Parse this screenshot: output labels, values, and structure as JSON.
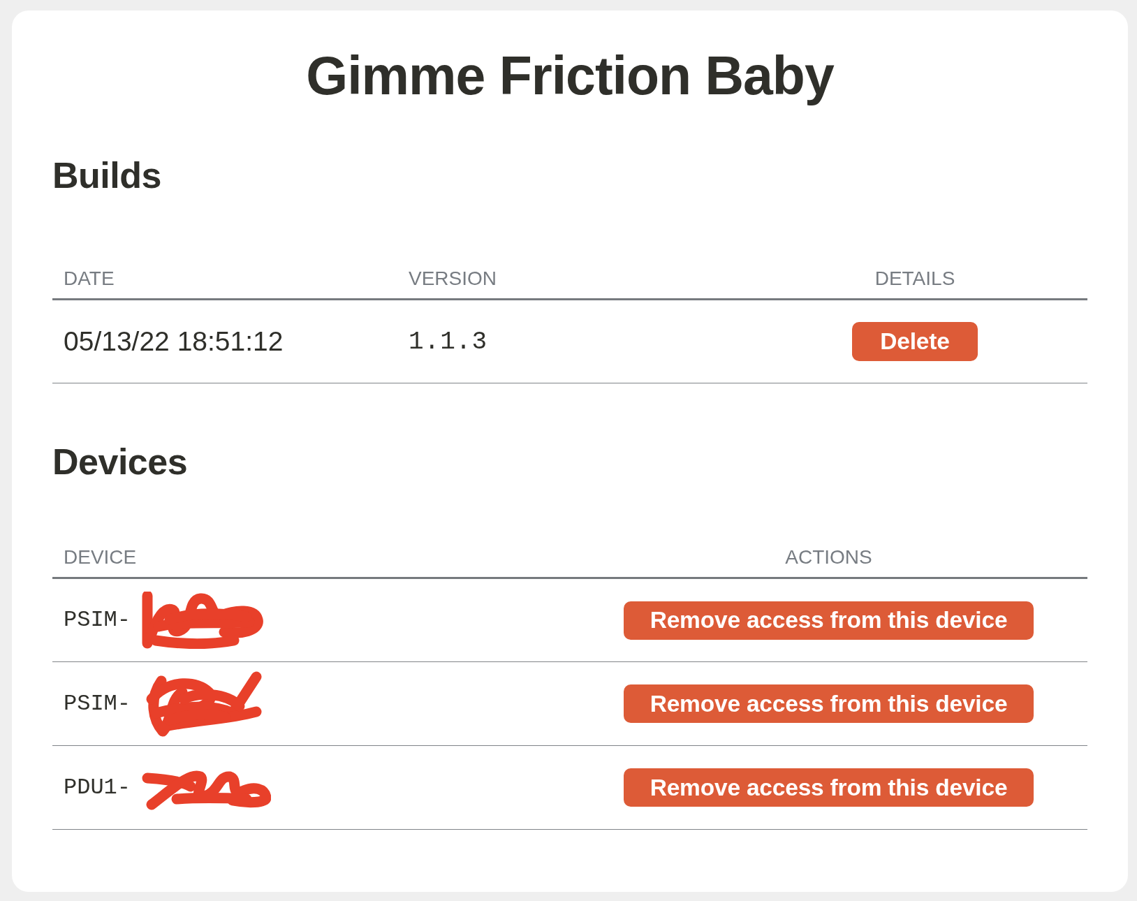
{
  "title": "Gimme Friction Baby",
  "builds": {
    "heading": "Builds",
    "columns": [
      "DATE",
      "VERSION",
      "DETAILS"
    ],
    "rows": [
      {
        "date": "05/13/22 18:51:12",
        "version": "1.1.3",
        "action": "Delete"
      }
    ]
  },
  "devices": {
    "heading": "Devices",
    "columns": [
      "DEVICE",
      "ACTIONS"
    ],
    "rows": [
      {
        "device": "PSIM-",
        "redacted": true,
        "action": "Remove access from this device"
      },
      {
        "device": "PSIM-",
        "redacted": true,
        "action": "Remove access from this device"
      },
      {
        "device": "PDU1-",
        "redacted": true,
        "action": "Remove access from this device"
      }
    ]
  }
}
